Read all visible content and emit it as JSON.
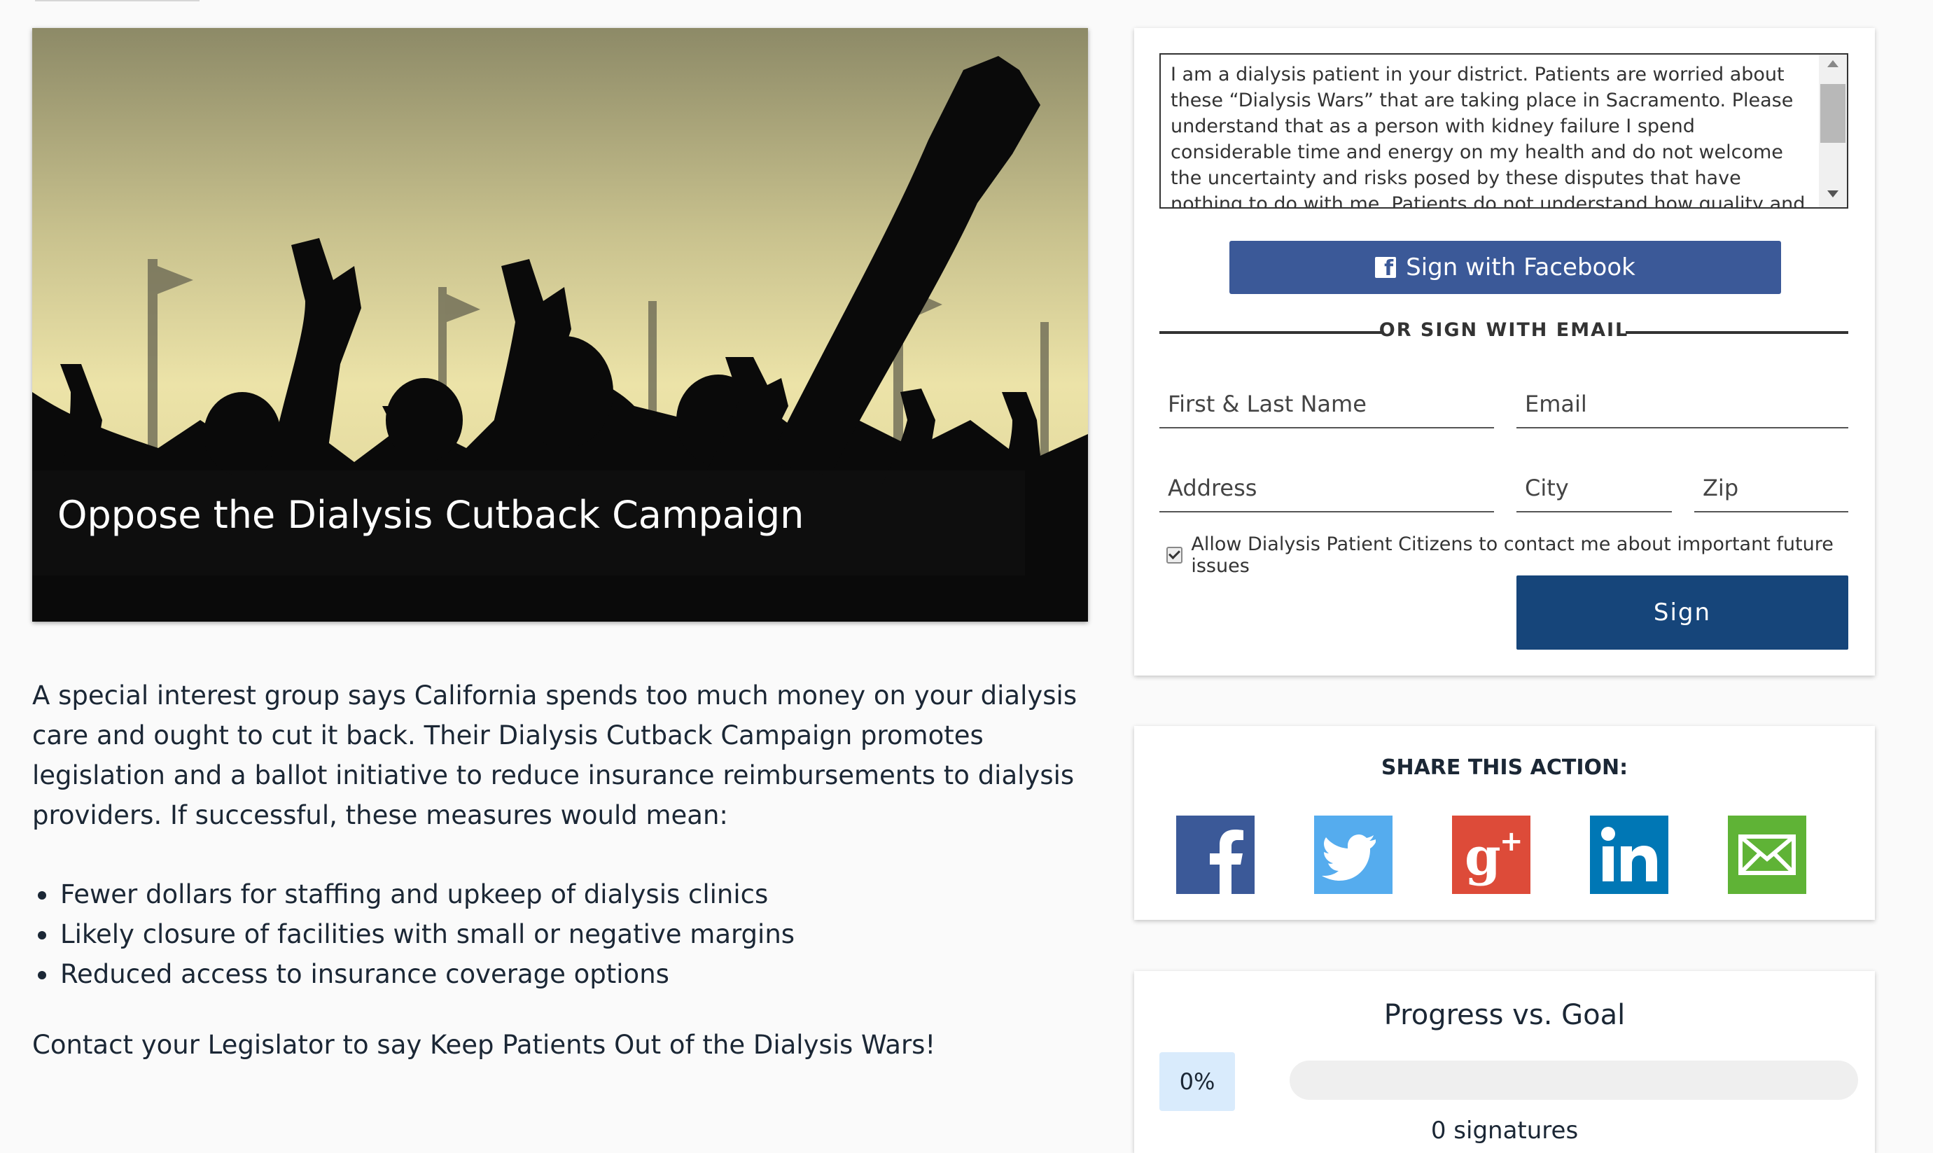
{
  "hero": {
    "title": "Oppose the Dialysis Cutback Campaign"
  },
  "article": {
    "intro": "A special interest group says California spends too much money on your dialysis care and ought to cut it back. Their Dialysis Cutback Campaign promotes legislation and a ballot initiative to reduce insurance reimbursements to dialysis providers. If successful, these measures would mean:",
    "bullets": [
      "Fewer dollars for staffing and upkeep of dialysis clinics",
      "Likely closure of facilities with small or negative margins",
      "Reduced access to insurance coverage options"
    ],
    "cta": "Contact your Legislator to say Keep Patients Out of the Dialysis Wars!"
  },
  "sign_form": {
    "letter": "I am a dialysis patient in your district. Patients are worried about these “Dialysis Wars” that are taking place in Sacramento. Please understand that as a person with kidney failure I spend considerable time and energy on my health and do not welcome the uncertainty and risks posed by these disputes that have nothing to do with me.  Patients do not understand how quality and access can improve by cutting back",
    "facebook_label": "Sign with Facebook",
    "divider_label": "OR SIGN WITH EMAIL",
    "fields": {
      "name": "First & Last Name",
      "email": "Email",
      "address": "Address",
      "city": "City",
      "zip": "Zip"
    },
    "consent_label": "Allow Dialysis Patient Citizens to contact me about important future issues",
    "consent_checked": true,
    "sign_label": "Sign"
  },
  "share": {
    "title": "SHARE THIS ACTION:",
    "icons": [
      {
        "name": "facebook-icon",
        "color": "#3b5998"
      },
      {
        "name": "twitter-icon",
        "color": "#55acee"
      },
      {
        "name": "google-plus-icon",
        "color": "#dd4b39"
      },
      {
        "name": "linkedin-icon",
        "color": "#0077b5"
      },
      {
        "name": "email-icon",
        "color": "#5fb336"
      }
    ]
  },
  "progress": {
    "title": "Progress vs. Goal",
    "percent_label": "0%",
    "percent_value": 0,
    "signatures_label": "0 signatures"
  }
}
